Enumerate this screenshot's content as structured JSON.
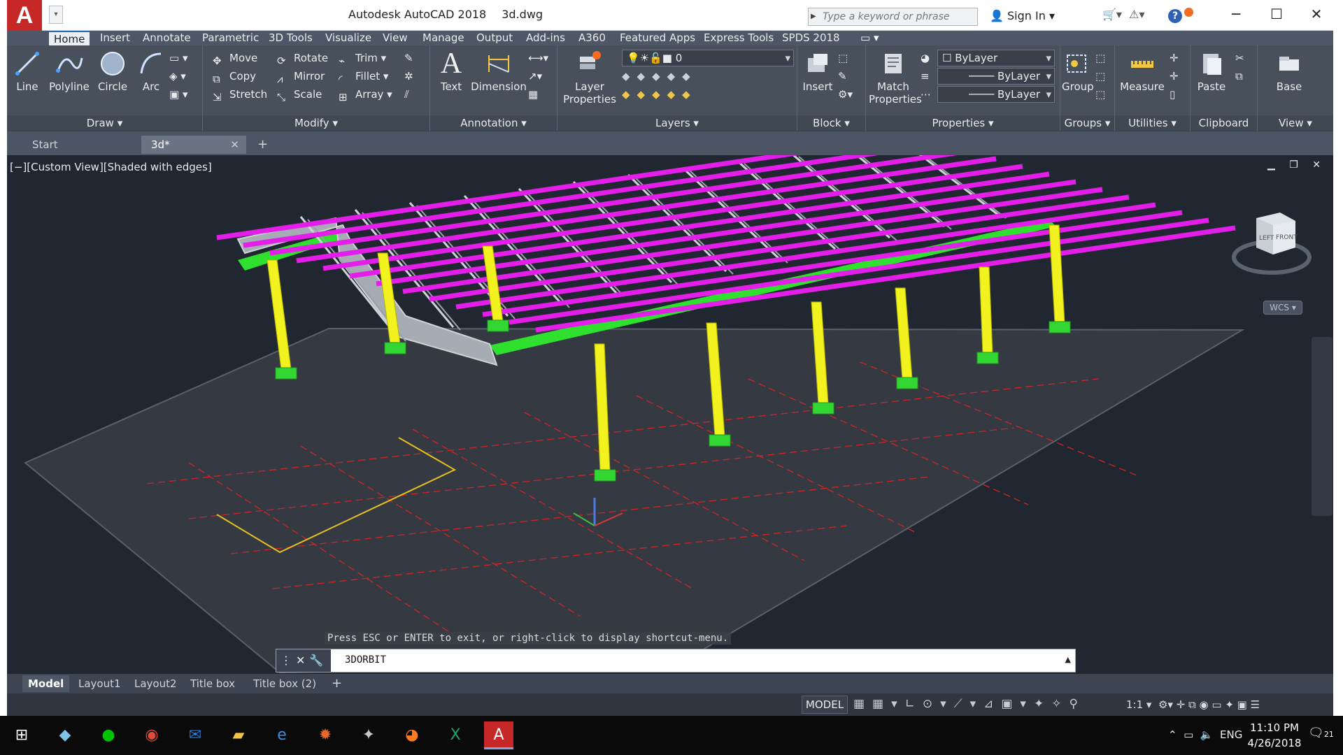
{
  "titlebar": {
    "app_name": "Autodesk AutoCAD 2018",
    "file_name": "3d.dwg",
    "search_placeholder": "Type a keyword or phrase",
    "signin_label": "Sign In"
  },
  "ribbon_tabs": [
    "Home",
    "Insert",
    "Annotate",
    "Parametric",
    "3D Tools",
    "Visualize",
    "View",
    "Manage",
    "Output",
    "Add-ins",
    "A360",
    "Featured Apps",
    "Express Tools",
    "SPDS 2018"
  ],
  "ribbon": {
    "draw": {
      "label": "Draw",
      "tools": [
        "Line",
        "Polyline",
        "Circle",
        "Arc"
      ]
    },
    "modify": {
      "label": "Modify",
      "tools": [
        "Move",
        "Rotate",
        "Trim",
        "Copy",
        "Mirror",
        "Fillet",
        "Stretch",
        "Scale",
        "Array"
      ]
    },
    "annotation": {
      "label": "Annotation",
      "tools": [
        "Text",
        "Dimension"
      ]
    },
    "layers": {
      "label": "Layers",
      "layer_properties": "Layer Properties",
      "current_layer": "0"
    },
    "block": {
      "label": "Block",
      "insert": "Insert"
    },
    "properties": {
      "label": "Properties",
      "match": "Match Properties",
      "color": "ByLayer",
      "linetype": "ByLayer",
      "lineweight": "ByLayer"
    },
    "groups": {
      "label": "Groups",
      "group": "Group"
    },
    "utilities": {
      "label": "Utilities",
      "measure": "Measure"
    },
    "clipboard": {
      "label": "Clipboard",
      "paste": "Paste"
    },
    "view": {
      "label": "View",
      "base": "Base"
    }
  },
  "doc_tabs": [
    "Start",
    "3d*"
  ],
  "viewport": {
    "label": "[−][Custom View][Shaded with edges]",
    "cube_left": "LEFT",
    "cube_front": "FRONT",
    "wcs": "WCS"
  },
  "command": {
    "prompt": "Press ESC or ENTER to exit, or right-click to display shortcut-menu.",
    "current": "3DORBIT"
  },
  "layout_tabs": [
    "Model",
    "Layout1",
    "Layout2",
    "Title box",
    "Title box (2)"
  ],
  "status": {
    "model": "MODEL",
    "scale": "1:1"
  },
  "taskbar": {
    "lang": "ENG",
    "time": "11:10 PM",
    "date": "4/26/2018",
    "notifications": "21"
  },
  "colors": {
    "accent": "#2d6bb8",
    "ribbon_bg": "#48505c",
    "viewport_bg": "#212730",
    "purlins": "#e21ee8",
    "columns": "#f2f21e",
    "beams": "#2fe02f",
    "trusses": "#cfd3d8",
    "grid_lines": "#d02525"
  }
}
